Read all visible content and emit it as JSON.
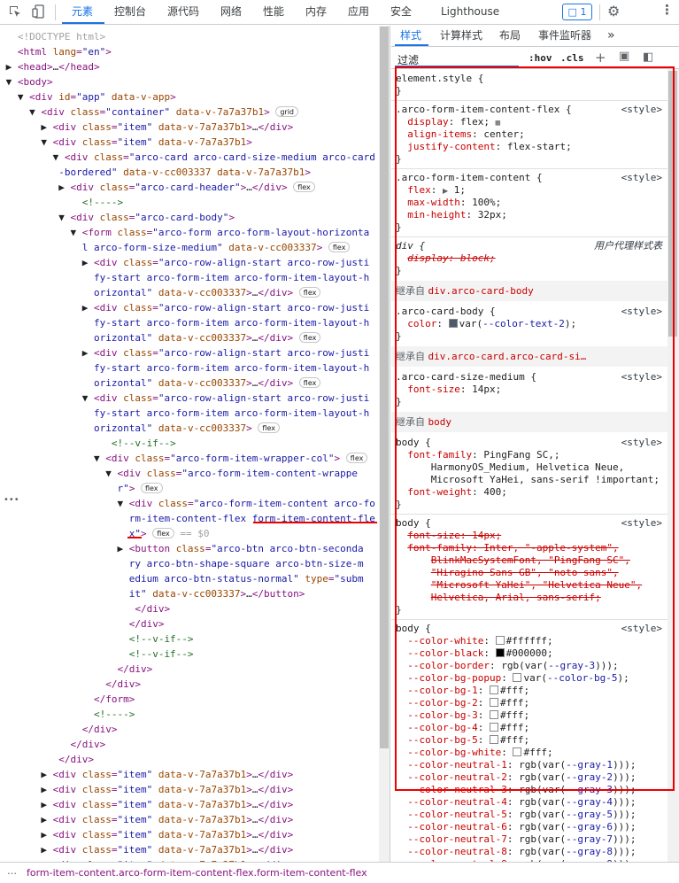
{
  "topbar": {
    "tabs": [
      "元素",
      "控制台",
      "源代码",
      "网络",
      "性能",
      "内存",
      "应用",
      "安全",
      "Lighthouse"
    ],
    "badge_count": "1"
  },
  "elements": [
    [
      "!DOCTYPE html"
    ],
    [
      "html lang=\"en\""
    ],
    [
      "head"
    ],
    [
      "body"
    ],
    [
      "div id=\"app\" data-v-app"
    ],
    [
      "div class=\"container\" data-v-7a7a37b1"
    ],
    [
      "div class=\"item\""
    ],
    [
      "div class=\"item\" data-v-7a7a37b1"
    ],
    [
      "div class=\"arco-card arco-card-size-medium arco-card-bordered\""
    ],
    [
      "div class=\"arco-card-header\""
    ],
    [
      "div class=\"arco-card-body\""
    ],
    [
      "form"
    ],
    [
      "div class=\"arco-form-item-content arco-form-item-content-flex form-item-content-flex\""
    ]
  ],
  "breadcrumb": "form-item-content.arco-form-item-content-flex.form-item-content-flex",
  "styles": {
    "tabs": [
      "样式",
      "计算样式",
      "布局",
      "事件监听器"
    ],
    "filter_placeholder": "过滤",
    "hov": ":hov",
    "cls": ".cls",
    "element_style": "element.style {",
    "source_style": "<style>",
    "ua_label": "用户代理样式表",
    "inherited_prefix": "继承自",
    "inh1": "div.arco-card-body",
    "inh2": "div.arco-card.arco-card-si…",
    "inh3": "body",
    "sel1": ".arco-form-item-content-flex {",
    "sel2": ".arco-form-item-content {",
    "sel3": "div {",
    "sel4": ".arco-card-body {",
    "sel5": ".arco-card-size-medium {",
    "sel6": "body {"
  }
}
